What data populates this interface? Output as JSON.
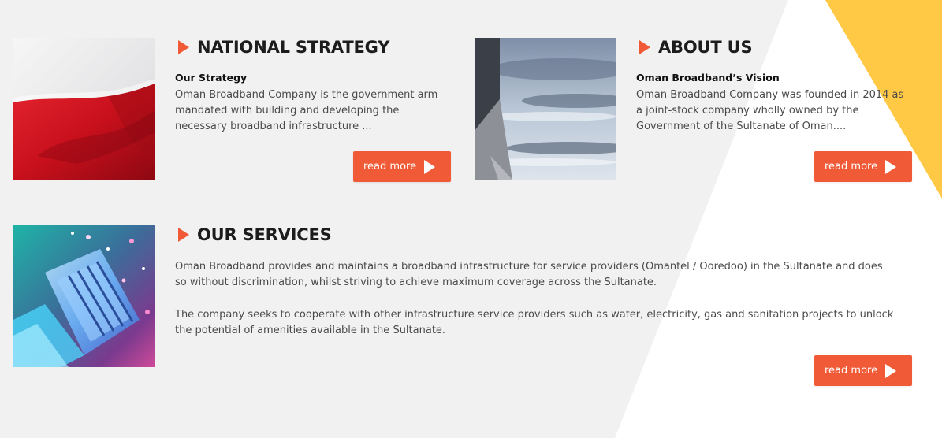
{
  "colors": {
    "accent": "#f15a36",
    "background": "#f1f1f2",
    "yellow_shape": "#ffc845",
    "white_shape": "#ffffff"
  },
  "national_strategy": {
    "heading": "NATIONAL STRATEGY",
    "subheading": "Our Strategy",
    "body": "Oman Broadband Company is the government arm mandated with building and developing the necessary broadband infrastructure ...",
    "button": "read more",
    "image": "red-white-flag-image"
  },
  "about_us": {
    "heading": "ABOUT US",
    "subheading": "Oman Broadband’s Vision",
    "body": "Oman Broadband Company was founded in 2014 as a joint-stock company wholly owned by the Government of the Sultanate of Oman....",
    "button": "read more",
    "image": "sky-clouds-image"
  },
  "our_services": {
    "heading": "OUR SERVICES",
    "paragraph_1": "Oman Broadband provides and maintains a broadband infrastructure for service providers (Omantel / Ooredoo) in the Sultanate and does so without discrimination, whilst striving to achieve maximum coverage across the Sultanate.",
    "paragraph_2": "The company seeks to cooperate with other infrastructure service providers such as water, electricity, gas and sanitation projects to unlock the potential of amenities available in the Sultanate.",
    "button": "read more",
    "image": "fiber-network-cable-image"
  },
  "icons": {
    "heading_marker": "play-triangle-icon",
    "button_icon": "play-arrow-icon"
  }
}
